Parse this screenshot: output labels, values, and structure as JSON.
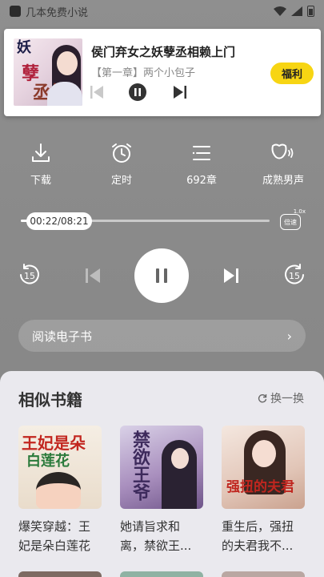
{
  "status_bar": {
    "app_name": "几本免费小说"
  },
  "notification": {
    "title": "侯门弃女之妖孽丞相赖上门",
    "chapter": "【第一章】两个小包子",
    "fuli_label": "福利",
    "cover_text": [
      "妖",
      "孽",
      "丞相"
    ]
  },
  "actions": [
    {
      "label": "下载",
      "icon": "download-icon"
    },
    {
      "label": "定时",
      "icon": "alarm-clock-icon"
    },
    {
      "label": "692章",
      "icon": "chapter-list-icon"
    },
    {
      "label": "成熟男声",
      "icon": "voice-icon"
    }
  ],
  "player": {
    "time": "00:22/08:21",
    "progress": 0.044,
    "speed_label": "倍速",
    "speed_value": "1.0x",
    "rewind_label": "15",
    "forward_label": "15"
  },
  "read_ebook": {
    "label": "阅读电子书",
    "chevron": "›"
  },
  "similar": {
    "title": "相似书籍",
    "refresh_label": "换一换",
    "books": [
      {
        "name": "爆笑穿越：王妃是朵白莲花",
        "cover_text_1": "王妃是朵",
        "cover_text_2": "白莲花"
      },
      {
        "name": "她请旨求和离，禁欲王...",
        "cover_text_1": "禁欲王爷"
      },
      {
        "name": "重生后，强扭的夫君我不...",
        "cover_text_1": "强扭的夫君"
      }
    ]
  }
}
